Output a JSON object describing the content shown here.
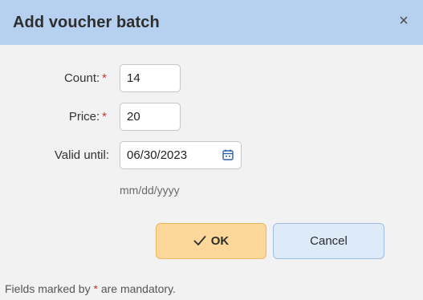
{
  "dialog": {
    "title": "Add voucher batch",
    "close_label": "×"
  },
  "form": {
    "count": {
      "label": "Count:",
      "required_mark": "*",
      "value": "14"
    },
    "price": {
      "label": "Price:",
      "required_mark": "*",
      "value": "20"
    },
    "valid_until": {
      "label": "Valid until:",
      "value": "06/30/2023",
      "format_hint": "mm/dd/yyyy"
    }
  },
  "buttons": {
    "ok_label": "OK",
    "cancel_label": "Cancel"
  },
  "footer": {
    "note_before": "Fields marked by ",
    "note_mark": "*",
    "note_after": " are mandatory."
  },
  "icons": {
    "close": "close-icon",
    "calendar": "calendar-icon",
    "check": "checkmark-icon"
  },
  "colors": {
    "titlebar": "#b6d1ef",
    "ok_button": "#fbd89a",
    "cancel_button": "#ddeaf8",
    "required": "#d0342c"
  }
}
